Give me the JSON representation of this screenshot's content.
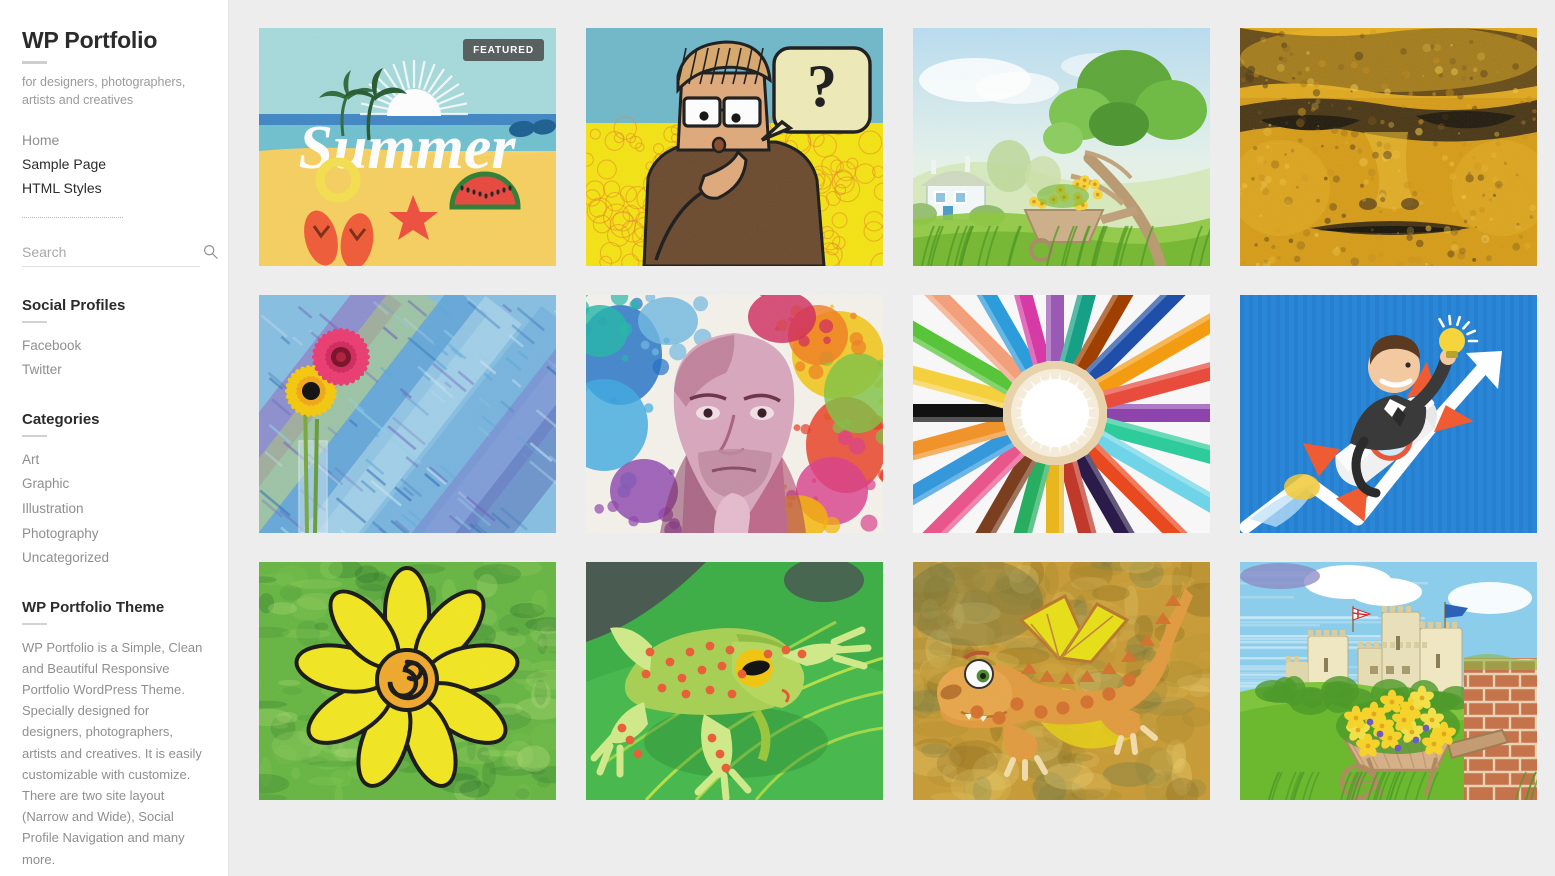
{
  "site": {
    "title": "WP Portfolio",
    "description": "for designers, photographers, artists and creatives"
  },
  "nav": {
    "items": [
      {
        "label": "Home",
        "active": false
      },
      {
        "label": "Sample Page",
        "active": true
      },
      {
        "label": "HTML Styles",
        "active": true
      }
    ]
  },
  "search": {
    "placeholder": "Search",
    "value": "",
    "icon": "search-icon"
  },
  "widgets": {
    "social": {
      "title": "Social Profiles",
      "items": [
        "Facebook",
        "Twitter"
      ]
    },
    "categories": {
      "title": "Categories",
      "items": [
        "Art",
        "Graphic",
        "Illustration",
        "Photography",
        "Uncategorized"
      ]
    },
    "about": {
      "title": "WP Portfolio Theme",
      "text": "WP Portfolio is a Simple, Clean and Beautiful Responsive Portfolio WordPress Theme. Specially designed for designers, photographers, artists and creatives. It is easily customizable with customize. There are two site layout (Narrow and Wide), Social Profile Navigation and many more."
    }
  },
  "portfolio": {
    "badge_label": "FEATURED",
    "items": [
      {
        "id": "summer-beach",
        "alt": "Summer beach illustration with sun, palm trees, watermelon and flip flops",
        "featured": true
      },
      {
        "id": "thinking-man",
        "alt": "Cartoon man thinking with question mark speech bubble",
        "featured": false
      },
      {
        "id": "cottage-landscape",
        "alt": "Watercolour cottage landscape with tree and wheelbarrow",
        "featured": false
      },
      {
        "id": "buddha-face",
        "alt": "Golden Buddha face close up",
        "featured": false
      },
      {
        "id": "gerbera-flowers",
        "alt": "Pink and yellow gerbera flowers in a glass vase on blue painted background",
        "featured": false
      },
      {
        "id": "portrait-splash",
        "alt": "Colourful watercolour splash portrait of a man",
        "featured": false
      },
      {
        "id": "colored-pencils",
        "alt": "Colored pencils arranged in a circle",
        "featured": false
      },
      {
        "id": "rocket-businessman",
        "alt": "Businessman riding a rocket holding a light bulb",
        "featured": false
      },
      {
        "id": "yellow-flower",
        "alt": "Hand drawn yellow flower on green grunge background",
        "featured": false
      },
      {
        "id": "paper-frog",
        "alt": "Green paper frog with red spots on a leaf",
        "featured": false
      },
      {
        "id": "cartoon-dragon",
        "alt": "Cartoon orange dragon flying on grunge gold background",
        "featured": false
      },
      {
        "id": "castle-wheelbarrow",
        "alt": "Castle with flower filled wheelbarrow and brick wall",
        "featured": false
      }
    ]
  },
  "colors": {
    "sidebar_bg": "#ffffff",
    "main_bg": "#ededed",
    "heading": "#2b2b2b",
    "muted_text": "#8f8f8f",
    "badge_bg": "#4e4e4e"
  }
}
